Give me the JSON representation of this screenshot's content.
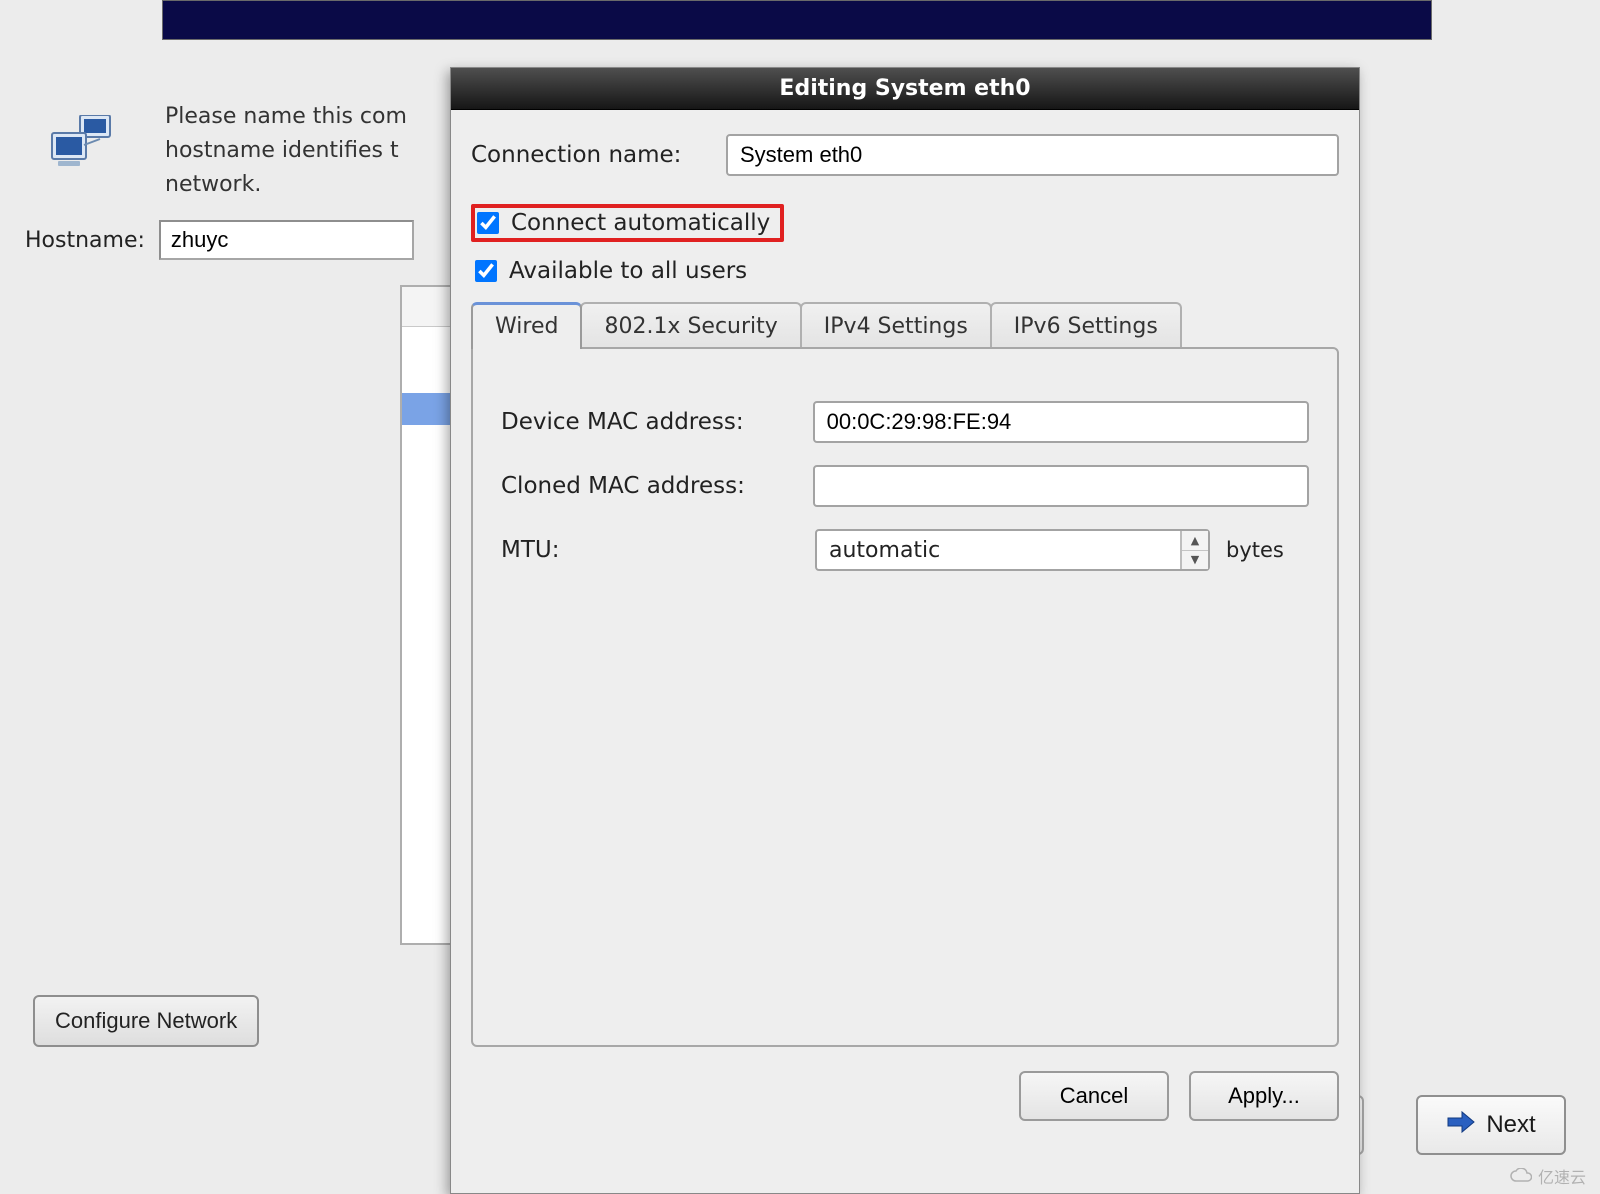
{
  "under": {
    "text_line1": "Please name this com",
    "text_line2": "hostname identifies t",
    "text_line3": "network.",
    "hostname_label": "Hostname:",
    "hostname_value": "zhuyc",
    "configure_label": "Configure Network",
    "next_label": "Next"
  },
  "dialog": {
    "title": "Editing System eth0",
    "conn_name_label": "Connection name:",
    "conn_name_value": "System eth0",
    "connect_auto_label": "Connect automatically",
    "connect_auto_checked": true,
    "avail_all_label": "Available to all users",
    "avail_all_checked": true,
    "tabs": [
      {
        "label": "Wired",
        "active": true
      },
      {
        "label": "802.1x Security",
        "active": false
      },
      {
        "label": "IPv4 Settings",
        "active": false
      },
      {
        "label": "IPv6 Settings",
        "active": false
      }
    ],
    "wired": {
      "device_mac_label": "Device MAC address:",
      "device_mac_value": "00:0C:29:98:FE:94",
      "cloned_mac_label": "Cloned MAC address:",
      "cloned_mac_value": "",
      "mtu_label": "MTU:",
      "mtu_value": "automatic",
      "mtu_unit": "bytes"
    },
    "cancel_label": "Cancel",
    "apply_label": "Apply..."
  },
  "watermark": "亿速云"
}
